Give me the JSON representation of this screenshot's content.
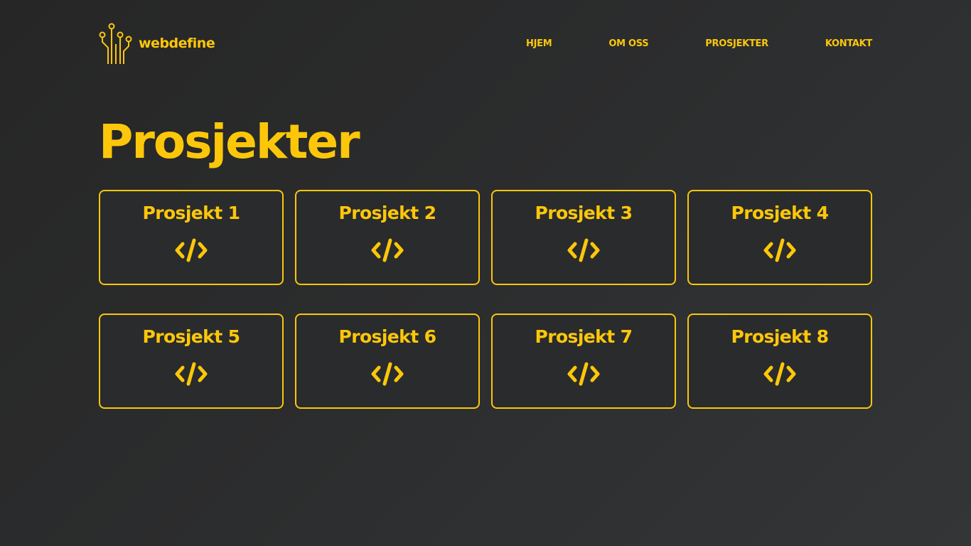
{
  "header": {
    "logo_text": "webdefine",
    "logo_icon": "circuit-icon",
    "nav": [
      {
        "label": "HJEM"
      },
      {
        "label": "OM OSS"
      },
      {
        "label": "PROSJEKTER"
      },
      {
        "label": "KONTAKT"
      }
    ]
  },
  "main": {
    "title": "Prosjekter",
    "projects": [
      {
        "label": "Prosjekt 1",
        "icon": "code-icon"
      },
      {
        "label": "Prosjekt 2",
        "icon": "code-icon"
      },
      {
        "label": "Prosjekt 3",
        "icon": "code-icon"
      },
      {
        "label": "Prosjekt 4",
        "icon": "code-icon"
      },
      {
        "label": "Prosjekt 5",
        "icon": "code-icon"
      },
      {
        "label": "Prosjekt 6",
        "icon": "code-icon"
      },
      {
        "label": "Prosjekt 7",
        "icon": "code-icon"
      },
      {
        "label": "Prosjekt 8",
        "icon": "code-icon"
      }
    ]
  },
  "colors": {
    "accent": "#fcc70a",
    "background": "#2c2d2e"
  }
}
